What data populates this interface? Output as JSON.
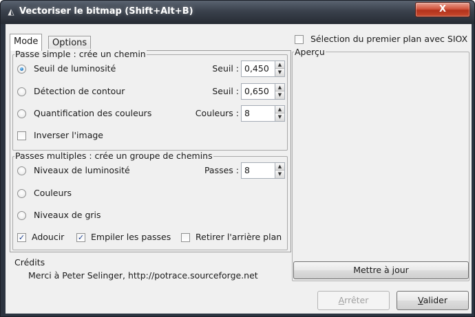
{
  "window": {
    "title": "Vectoriser le bitmap (Shift+Alt+B)",
    "close_glyph": "X",
    "app_icon": "inkscape-icon"
  },
  "tabs": [
    {
      "label": "Mode",
      "active": true
    },
    {
      "label": "Options",
      "active": false
    }
  ],
  "single_pass": {
    "legend": "Passe simple : crée un chemin",
    "options": [
      {
        "label": "Seuil de luminosité",
        "checked": true,
        "spin_label": "Seuil :",
        "spin_value": "0,450"
      },
      {
        "label": "Détection de contour",
        "checked": false,
        "spin_label": "Seuil :",
        "spin_value": "0,650"
      },
      {
        "label": "Quantification des couleurs",
        "checked": false,
        "spin_label": "Couleurs :",
        "spin_value": "8"
      }
    ],
    "invert": {
      "label": "Inverser l'image",
      "checked": false
    }
  },
  "multi_pass": {
    "legend": "Passes multiples : crée un groupe de chemins",
    "options": [
      {
        "label": "Niveaux de luminosité",
        "checked": false,
        "spin_label": "Passes :",
        "spin_value": "8"
      },
      {
        "label": "Couleurs",
        "checked": false
      },
      {
        "label": "Niveaux de gris",
        "checked": false
      }
    ],
    "checks": [
      {
        "label": "Adoucir",
        "checked": true
      },
      {
        "label": "Empiler les passes",
        "checked": true
      },
      {
        "label": "Retirer l'arrière plan",
        "checked": false
      }
    ]
  },
  "credits": {
    "title": "Crédits",
    "text": "Merci à Peter Selinger, http://potrace.sourceforge.net"
  },
  "siox": {
    "label": "Sélection du premier plan avec SIOX",
    "checked": false
  },
  "preview": {
    "legend": "Aperçu"
  },
  "buttons": {
    "update": "Mettre à jour",
    "stop": "Arrêter",
    "ok": "Valider"
  },
  "check_glyph": "✓",
  "spin_up_glyph": "▲",
  "spin_down_glyph": "▼",
  "colors": {
    "titlebar": "#3a414c",
    "close_button": "#c8482e",
    "radio_selected": "#1d6fb8"
  }
}
